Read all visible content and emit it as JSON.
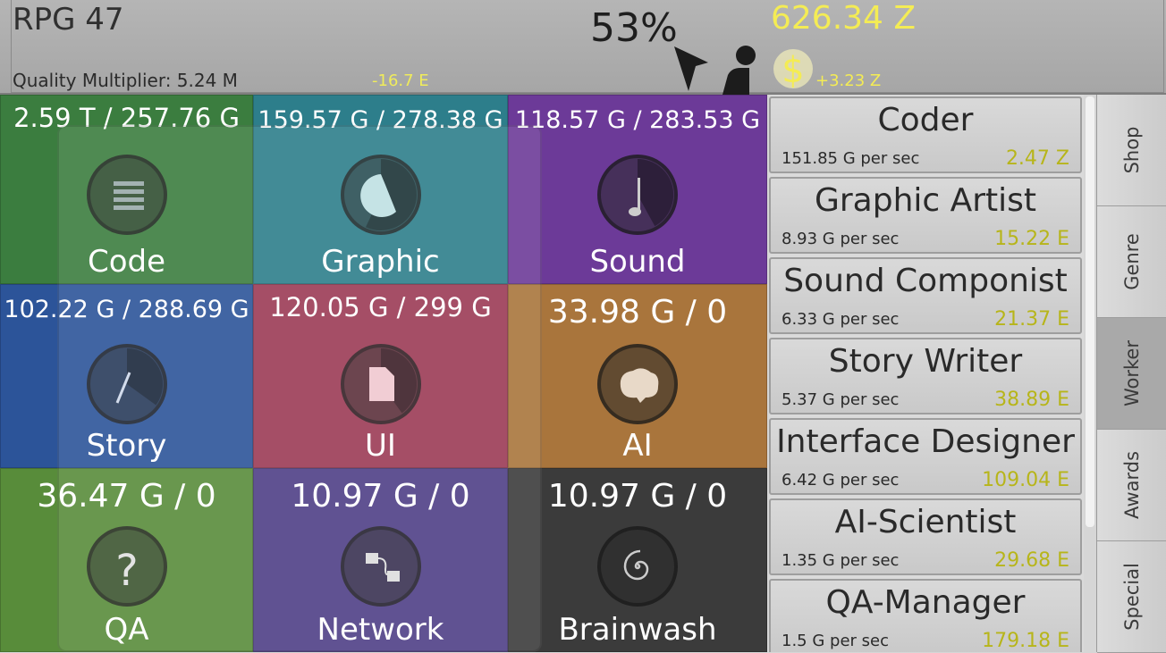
{
  "header": {
    "title": "RPG 47",
    "quality_multiplier": "Quality Multiplier: 5.24 M",
    "energy_rate": "-16.7 E",
    "percent": "53%",
    "money": "626.34 Z",
    "money_rate": "+3.23 Z",
    "dollar_symbol": "$"
  },
  "tiles": [
    {
      "value": "2.59 T / 257.76 G",
      "name": "Code",
      "color": "#3b7d3f",
      "icon": "code-icon",
      "progress": 1.0
    },
    {
      "value": "159.57 G / 278.38 G",
      "name": "Graphic",
      "color": "#2d7e8b",
      "icon": "graphic-icon",
      "progress": 0.57
    },
    {
      "value": "118.57 G / 283.53 G",
      "name": "Sound",
      "color": "#6c3a98",
      "icon": "sound-icon",
      "progress": 0.42
    },
    {
      "value": "102.22 G / 288.69 G",
      "name": "Story",
      "color": "#2c5499",
      "icon": "story-icon",
      "progress": 0.35
    },
    {
      "value": "120.05 G / 299 G",
      "name": "UI",
      "color": "#9b3a55",
      "icon": "ui-icon",
      "progress": 0.4
    },
    {
      "value": "33.98 G / 0",
      "name": "AI",
      "color": "#a9753c",
      "icon": "brain-icon",
      "progress": 1.0
    },
    {
      "value": "36.47 G / 0",
      "name": "QA",
      "color": "#588c3a",
      "icon": "question-icon",
      "progress": 1.0
    },
    {
      "value": "10.97 G / 0",
      "name": "Network",
      "color": "#4f3f86",
      "icon": "network-icon",
      "progress": 1.0
    },
    {
      "value": "10.97 G / 0",
      "name": "Brainwash",
      "color": "#3b3b3b",
      "icon": "spiral-icon",
      "progress": 1.0
    }
  ],
  "workers": [
    {
      "name": "Coder",
      "rate": "151.85 G per sec",
      "cost": "2.47 Z"
    },
    {
      "name": "Graphic Artist",
      "rate": "8.93 G per sec",
      "cost": "15.22 E"
    },
    {
      "name": "Sound Componist",
      "rate": "6.33 G per sec",
      "cost": "21.37 E"
    },
    {
      "name": "Story Writer",
      "rate": "5.37 G per sec",
      "cost": "38.89 E"
    },
    {
      "name": "Interface Designer",
      "rate": "6.42 G per sec",
      "cost": "109.04 E"
    },
    {
      "name": "AI-Scientist",
      "rate": "1.35 G per sec",
      "cost": "29.68 E"
    },
    {
      "name": "QA-Manager",
      "rate": "1.5 G per sec",
      "cost": "179.18 E"
    }
  ],
  "tabs": [
    {
      "label": "Shop",
      "active": false
    },
    {
      "label": "Genre",
      "active": false
    },
    {
      "label": "Worker",
      "active": true
    },
    {
      "label": "Awards",
      "active": false
    },
    {
      "label": "Special",
      "active": false
    }
  ]
}
